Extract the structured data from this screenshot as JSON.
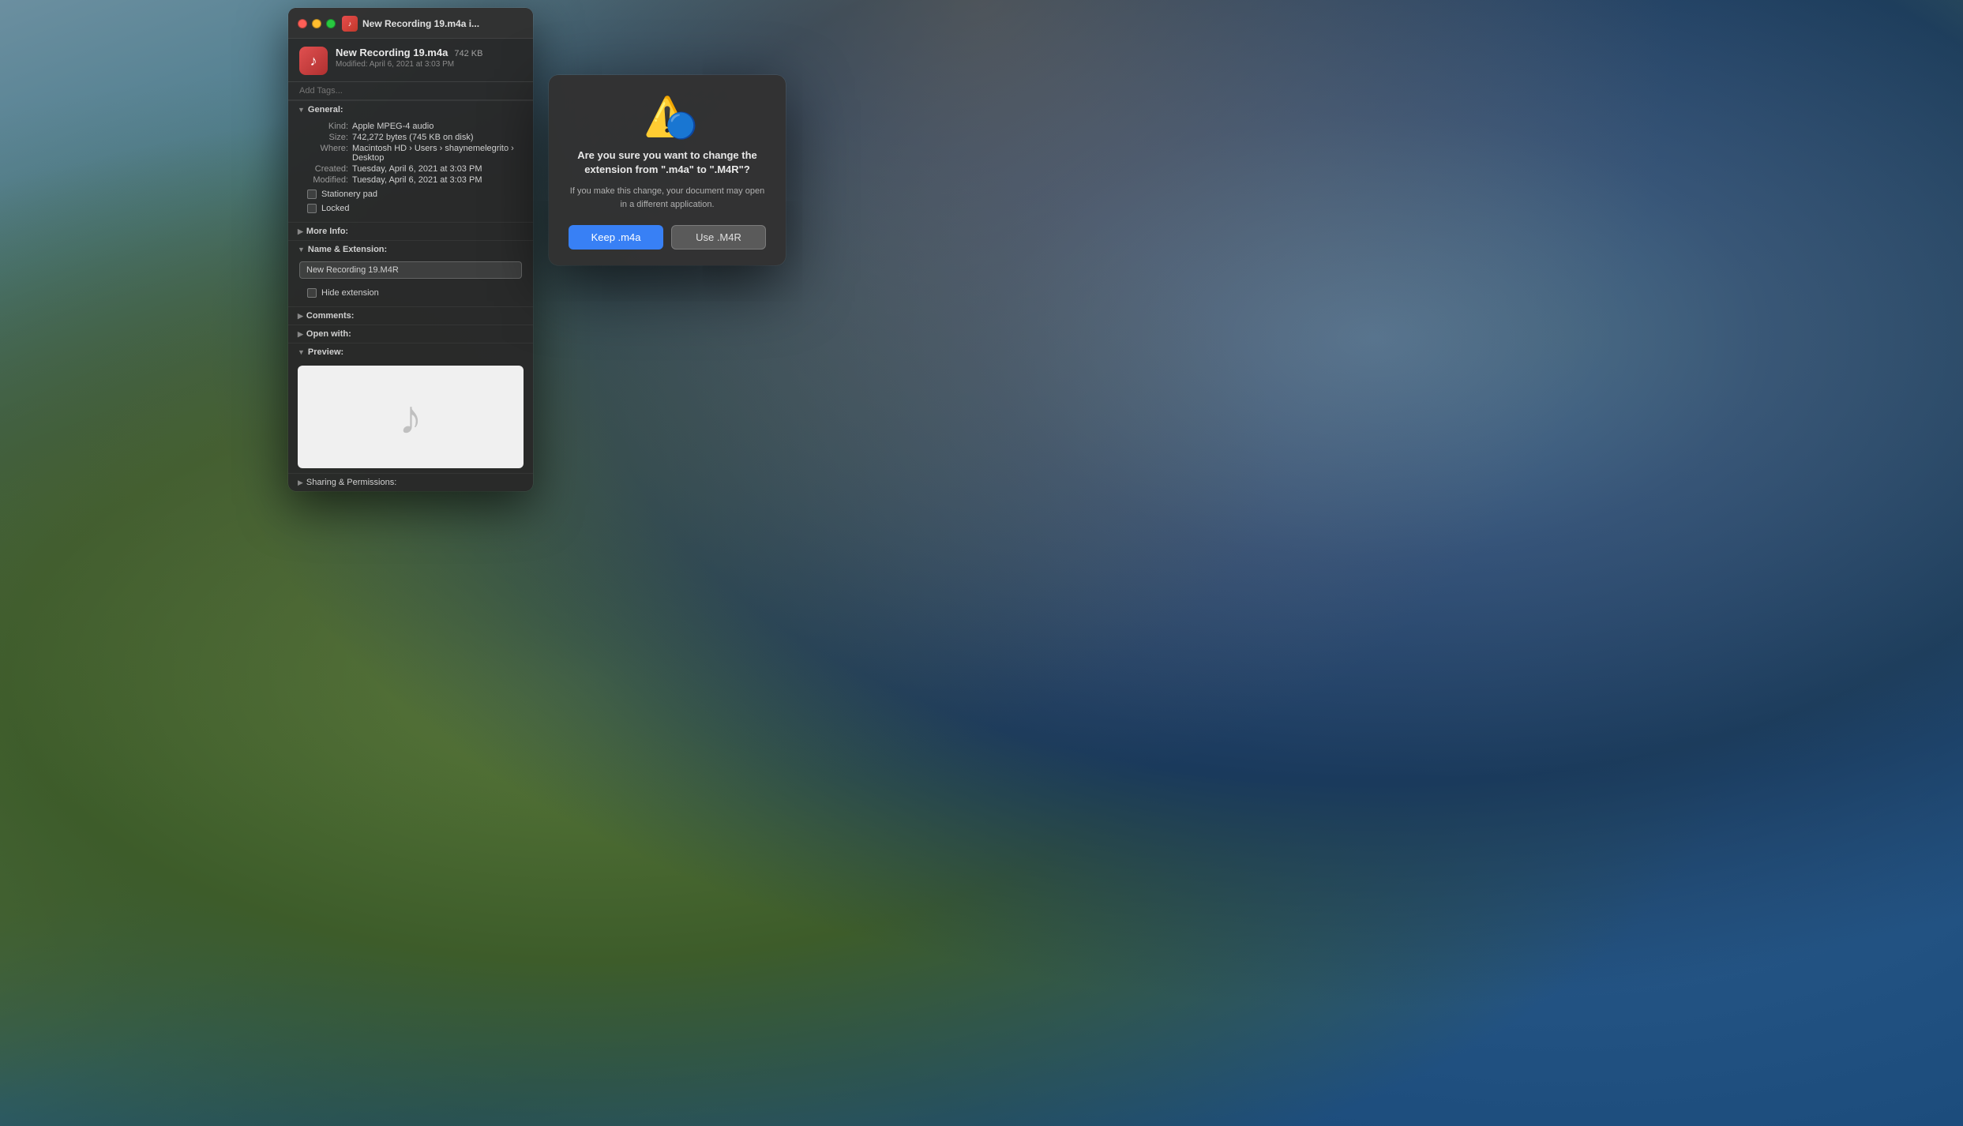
{
  "desktop": {
    "bg_description": "macOS Big Sur landscape wallpaper with mountains and ocean"
  },
  "info_window": {
    "title": "New Recording 19.m4a i...",
    "file_name": "New Recording 19.m4a",
    "file_size": "742 KB",
    "modified_label": "Modified: April 6, 2021 at 3:03 PM",
    "tags_placeholder": "Add Tags...",
    "general_section": "General:",
    "kind_label": "Kind:",
    "kind_value": "Apple MPEG-4 audio",
    "size_label": "Size:",
    "size_value": "742,272 bytes (745 KB on disk)",
    "where_label": "Where:",
    "where_value": "Macintosh HD › Users › shaynemelegrito › Desktop",
    "created_label": "Created:",
    "created_value": "Tuesday, April 6, 2021 at 3:03 PM",
    "modified_info_label": "Modified:",
    "modified_info_value": "Tuesday, April 6, 2021 at 3:03 PM",
    "stationery_label": "Stationery pad",
    "locked_label": "Locked",
    "more_info_section": "More Info:",
    "name_ext_section": "Name & Extension:",
    "file_name_field": "New Recording 19.M4R",
    "hide_extension_label": "Hide extension",
    "comments_section": "Comments:",
    "open_with_section": "Open with:",
    "preview_section": "Preview:",
    "sharing_section": "Sharing & Permissions:"
  },
  "alert_dialog": {
    "title": "Are you sure you want to change\nthe extension from \".m4a\" to\n\".M4R\"?",
    "message": "If you make this change, your document\nmay open in a different application.",
    "keep_button": "Keep .m4a",
    "use_button": "Use .M4R",
    "warning_icon": "⚠️",
    "finder_icon": "🔵"
  },
  "traffic_lights": {
    "close": "close",
    "minimize": "minimize",
    "maximize": "maximize"
  }
}
